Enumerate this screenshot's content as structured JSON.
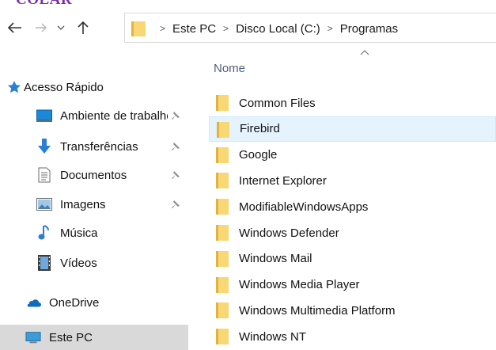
{
  "caption": {
    "text": "COLAR"
  },
  "toolbar": {
    "back_icon": "arrow-left-icon",
    "forward_icon": "arrow-right-icon",
    "recent_icon": "chevron-down-icon",
    "up_icon": "arrow-up-icon"
  },
  "address": {
    "icon": "folder-icon",
    "crumbs": [
      "Este PC",
      "Disco Local (C:)",
      "Programas"
    ],
    "separator": ">"
  },
  "sidebar": {
    "items": [
      {
        "label": "Acesso Rápido",
        "icon": "star-icon",
        "pinned": false
      },
      {
        "label": "Ambiente de trabalho",
        "icon": "desktop-icon",
        "pinned": true
      },
      {
        "label": "Transferências",
        "icon": "download-icon",
        "pinned": true
      },
      {
        "label": "Documentos",
        "icon": "document-icon",
        "pinned": true
      },
      {
        "label": "Imagens",
        "icon": "image-icon",
        "pinned": true
      },
      {
        "label": "Música",
        "icon": "music-icon",
        "pinned": false
      },
      {
        "label": "Vídeos",
        "icon": "video-icon",
        "pinned": false
      },
      {
        "label": "OneDrive",
        "icon": "cloud-icon",
        "pinned": false
      },
      {
        "label": "Este PC",
        "icon": "computer-icon",
        "pinned": false,
        "selected": true
      }
    ]
  },
  "list": {
    "column_header": "Nome",
    "sort_icon": "sort-ascending-icon",
    "items": [
      {
        "name": "Common Files"
      },
      {
        "name": "Firebird",
        "hover": true
      },
      {
        "name": "Google"
      },
      {
        "name": "Internet Explorer"
      },
      {
        "name": "ModifiableWindowsApps"
      },
      {
        "name": "Windows Defender"
      },
      {
        "name": "Windows Mail"
      },
      {
        "name": "Windows Media Player"
      },
      {
        "name": "Windows Multimedia Platform"
      },
      {
        "name": "Windows NT"
      }
    ]
  },
  "colors": {
    "caption": "#7a2fb0",
    "folder": "#f8d775",
    "folder_dark": "#e2b23f",
    "hover_row": "#e5f3ff",
    "selected_nav": "#d9d9d9",
    "header_text": "#4c607a"
  }
}
